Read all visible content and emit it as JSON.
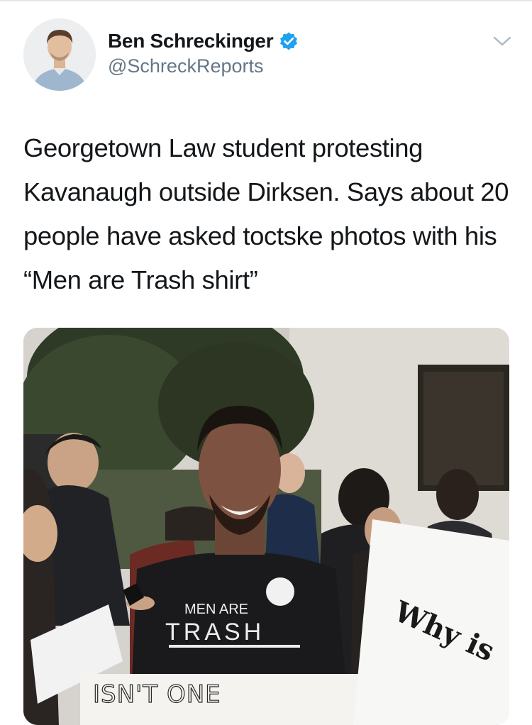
{
  "tweet": {
    "author_name": "Ben Schreckinger",
    "author_handle": "@SchreckReports",
    "verified": true,
    "text": "Georgetown Law student protesting Kavanaugh outside Dirksen. Says about 20 people have asked toctske photos with his “Men are Trash shirt”"
  },
  "photo": {
    "shirt_line1": "MEN ARE",
    "shirt_line2": "TRASH",
    "sign_left_text": "ISN'T ONE",
    "sign_right_text": "Why is"
  },
  "icons": {
    "verified": "verified-badge-icon",
    "menu": "chevron-down-icon"
  },
  "colors": {
    "verified_blue": "#1da1f2",
    "text_primary": "#14171a",
    "text_secondary": "#657786"
  }
}
